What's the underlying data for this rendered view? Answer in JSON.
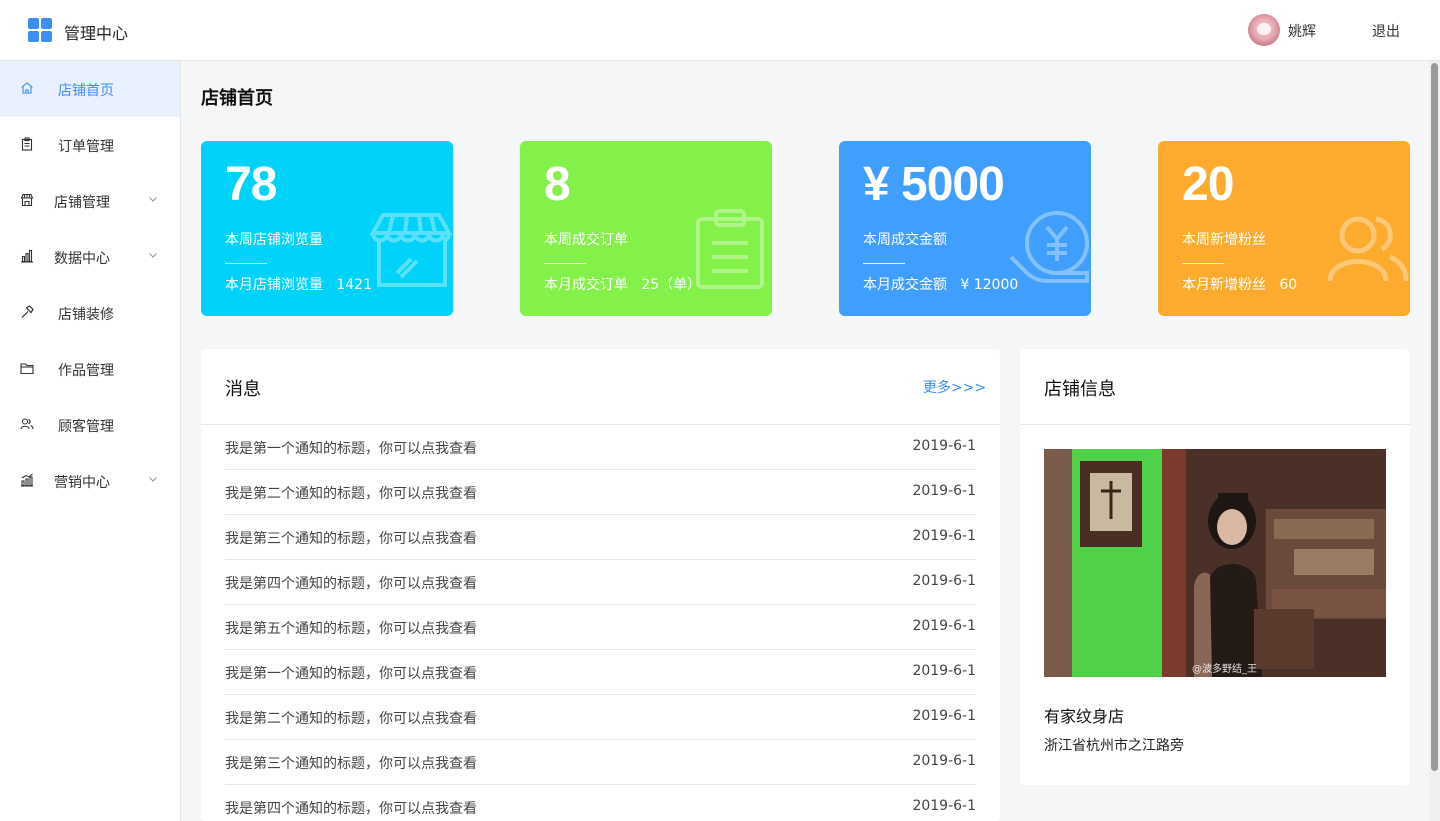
{
  "header": {
    "app_title": "管理中心",
    "username": "姚辉",
    "logout_label": "退出"
  },
  "sidebar": {
    "items": [
      {
        "label": "店铺首页",
        "icon": "home-icon",
        "active": true,
        "expandable": false
      },
      {
        "label": "订单管理",
        "icon": "clipboard-icon",
        "active": false,
        "expandable": false
      },
      {
        "label": "店铺管理",
        "icon": "store-icon",
        "active": false,
        "expandable": true
      },
      {
        "label": "数据中心",
        "icon": "bar-chart-icon",
        "active": false,
        "expandable": true
      },
      {
        "label": "店铺装修",
        "icon": "hammer-icon",
        "active": false,
        "expandable": false
      },
      {
        "label": "作品管理",
        "icon": "folder-icon",
        "active": false,
        "expandable": false
      },
      {
        "label": "顾客管理",
        "icon": "users-icon",
        "active": false,
        "expandable": false
      },
      {
        "label": "营销中心",
        "icon": "growth-chart-icon",
        "active": false,
        "expandable": true
      }
    ]
  },
  "main": {
    "page_title": "店铺首页",
    "stats": [
      {
        "value": "78",
        "week_label": "本周店铺浏览量",
        "month_label": "本月店铺浏览量",
        "month_value": "1421",
        "color": "#00d2fa",
        "icon": "store-icon"
      },
      {
        "value": "8",
        "week_label": "本周成交订单",
        "month_label": "本月成交订单",
        "month_value": "25（单）",
        "color": "#84f04a",
        "icon": "clipboard-icon"
      },
      {
        "value": "¥ 5000",
        "week_label": "本周成交金额",
        "month_label": "本月成交金额",
        "month_value": "¥ 12000",
        "color": "#409eff",
        "icon": "money-hand-icon"
      },
      {
        "value": "20",
        "week_label": "本周新增粉丝",
        "month_label": "本月新增粉丝",
        "month_value": "60",
        "color": "#fdab2e",
        "icon": "users-icon"
      }
    ],
    "messages": {
      "title": "消息",
      "more_label": "更多>>>",
      "rows": [
        {
          "title": "我是第一个通知的标题，你可以点我查看",
          "date": "2019-6-1"
        },
        {
          "title": "我是第二个通知的标题，你可以点我查看",
          "date": "2019-6-1"
        },
        {
          "title": "我是第三个通知的标题，你可以点我查看",
          "date": "2019-6-1"
        },
        {
          "title": "我是第四个通知的标题，你可以点我查看",
          "date": "2019-6-1"
        },
        {
          "title": "我是第五个通知的标题，你可以点我查看",
          "date": "2019-6-1"
        },
        {
          "title": "我是第一个通知的标题，你可以点我查看",
          "date": "2019-6-1"
        },
        {
          "title": "我是第二个通知的标题，你可以点我查看",
          "date": "2019-6-1"
        },
        {
          "title": "我是第三个通知的标题，你可以点我查看",
          "date": "2019-6-1"
        },
        {
          "title": "我是第四个通知的标题，你可以点我查看",
          "date": "2019-6-1"
        }
      ]
    },
    "shop": {
      "title": "店铺信息",
      "name": "有家纹身店",
      "address": "浙江省杭州市之江路旁",
      "photo_watermark": "@波多野结_王"
    }
  }
}
